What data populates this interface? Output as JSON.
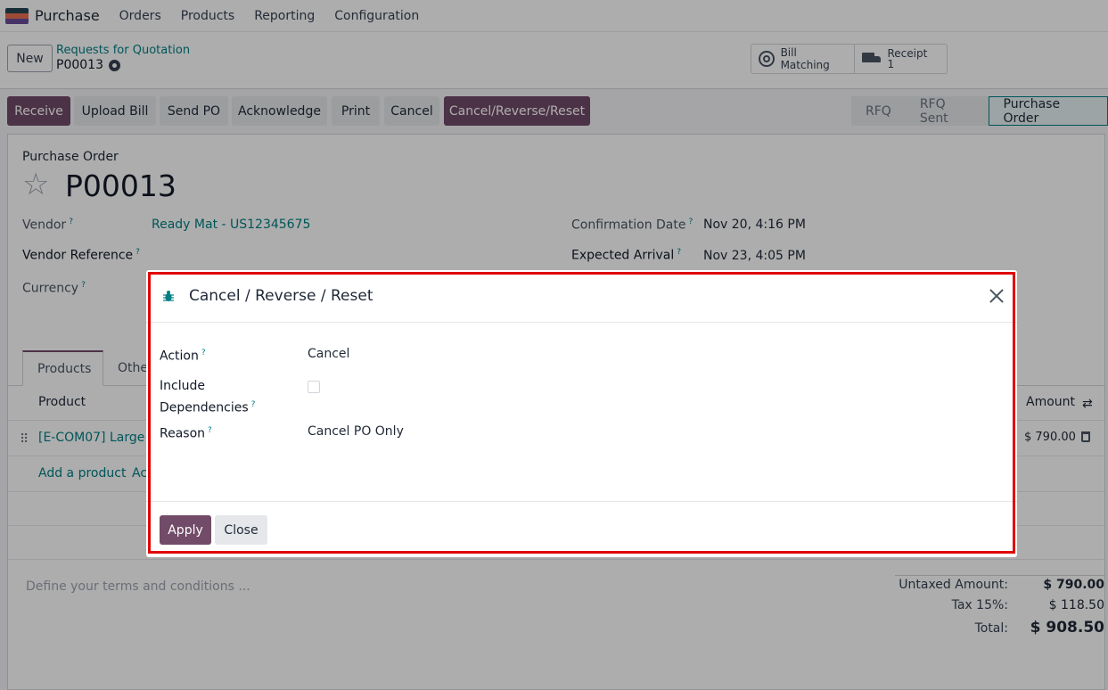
{
  "app": {
    "name": "Purchase",
    "logo_colors": [
      "#264653",
      "#e76f51",
      "#6b4c9a"
    ],
    "nav": [
      "Orders",
      "Products",
      "Reporting",
      "Configuration"
    ]
  },
  "control": {
    "new_label": "New",
    "breadcrumb": "Requests for Quotation",
    "record": "P00013",
    "smart_buttons": {
      "bill_matching": "Bill Matching",
      "receipt_label": "Receipt",
      "receipt_count": "1"
    }
  },
  "actions": [
    "Receive",
    "Upload Bill",
    "Send PO",
    "Acknowledge",
    "Print",
    "Cancel",
    "Cancel/Reverse/Reset"
  ],
  "stages": [
    "RFQ",
    "RFQ Sent",
    "Purchase Order"
  ],
  "active_stage": "Purchase Order",
  "form": {
    "type_label": "Purchase Order",
    "title": "P00013",
    "vendor_label": "Vendor",
    "vendor_value": "Ready Mat - US12345675",
    "vendor_ref_label": "Vendor Reference",
    "currency_label": "Currency",
    "confirmation_label": "Confirmation Date",
    "confirmation_value": "Nov 20, 4:16 PM",
    "arrival_label": "Expected Arrival",
    "arrival_value": "Nov 23, 4:05 PM",
    "help_mark": "?"
  },
  "tabs": [
    "Products",
    "Othe"
  ],
  "table": {
    "col_product": "Product",
    "col_amount": "Amount",
    "row_product": "[E-COM07] Large C",
    "row_amount": "$ 790.00",
    "add_product": "Add a product",
    "add_other": "Ac"
  },
  "terms_placeholder": "Define your terms and conditions ...",
  "totals": {
    "untaxed_label": "Untaxed Amount:",
    "untaxed_value": "$ 790.00",
    "tax_label": "Tax 15%:",
    "tax_value": "$ 118.50",
    "total_label": "Total:",
    "total_value": "$ 908.50"
  },
  "modal": {
    "title": "Cancel / Reverse / Reset",
    "action_label": "Action",
    "action_value": "Cancel",
    "include_label_1": "Include",
    "include_label_2": "Dependencies",
    "reason_label": "Reason",
    "reason_value": "Cancel PO Only",
    "apply_label": "Apply",
    "close_label": "Close",
    "help_mark": "?"
  },
  "colors": {
    "brand": "#714b67",
    "link": "#017e84",
    "highlight": "#e00000"
  }
}
